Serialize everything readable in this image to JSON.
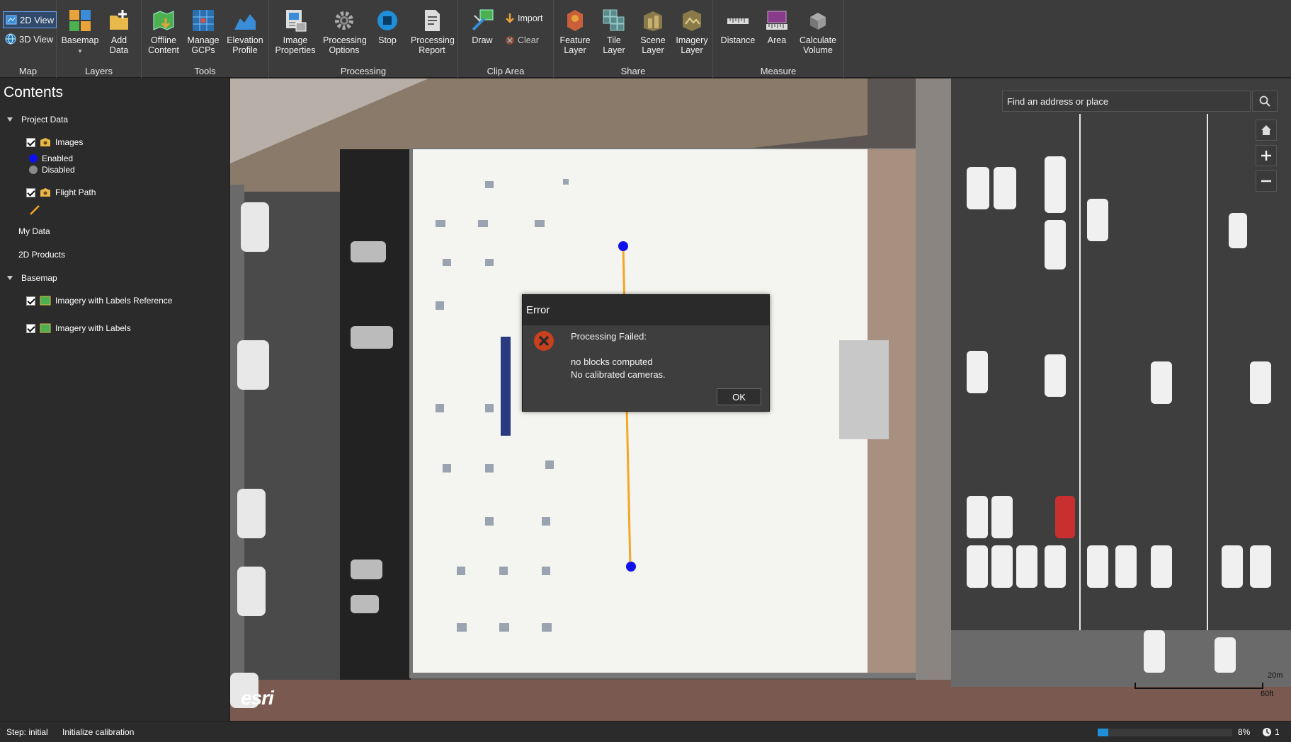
{
  "ribbon": {
    "view_2d": "2D View",
    "view_3d": "3D View",
    "groups": {
      "map": "Map",
      "layers": "Layers",
      "tools": "Tools",
      "processing": "Processing",
      "clip_area": "Clip Area",
      "share": "Share",
      "measure": "Measure"
    },
    "buttons": {
      "basemap": "Basemap",
      "add_data": "Add\nData",
      "offline_content": "Offline\nContent",
      "manage_gcps": "Manage\nGCPs",
      "elevation_profile": "Elevation\nProfile",
      "image_properties": "Image\nProperties",
      "processing_options": "Processing\nOptions",
      "stop": "Stop",
      "processing_report": "Processing\nReport",
      "draw": "Draw",
      "import": "Import",
      "clear": "Clear",
      "feature_layer": "Feature\nLayer",
      "tile_layer": "Tile\nLayer",
      "scene_layer": "Scene\nLayer",
      "imagery_layer": "Imagery\nLayer",
      "distance": "Distance",
      "area": "Area",
      "calculate_volume": "Calculate\nVolume"
    }
  },
  "sidebar": {
    "title": "Contents",
    "project_data": "Project Data",
    "images": "Images",
    "enabled": "Enabled",
    "disabled": "Disabled",
    "flight_path": "Flight Path",
    "my_data": "My Data",
    "products_2d": "2D Products",
    "basemap": "Basemap",
    "imagery_labels_ref": "Imagery with Labels Reference",
    "imagery_labels": "Imagery with Labels"
  },
  "map": {
    "search_placeholder": "Find an address or place",
    "scale_m": "20m",
    "scale_ft": "60ft",
    "esri": "esri"
  },
  "dialog": {
    "title": "Error",
    "line1": "Processing Failed:",
    "line2": "no blocks computed",
    "line3": "No calibrated cameras.",
    "ok": "OK"
  },
  "status": {
    "step": "Step: initial",
    "message": "Initialize calibration",
    "progress_fraction": 0.08,
    "progress_label": "8%",
    "clock_count": "1"
  },
  "colors": {
    "enabled_dot": "#1010ee",
    "disabled_dot": "#8a8a8a",
    "flight_path": "#f5a623",
    "error_icon": "#c8401e"
  }
}
